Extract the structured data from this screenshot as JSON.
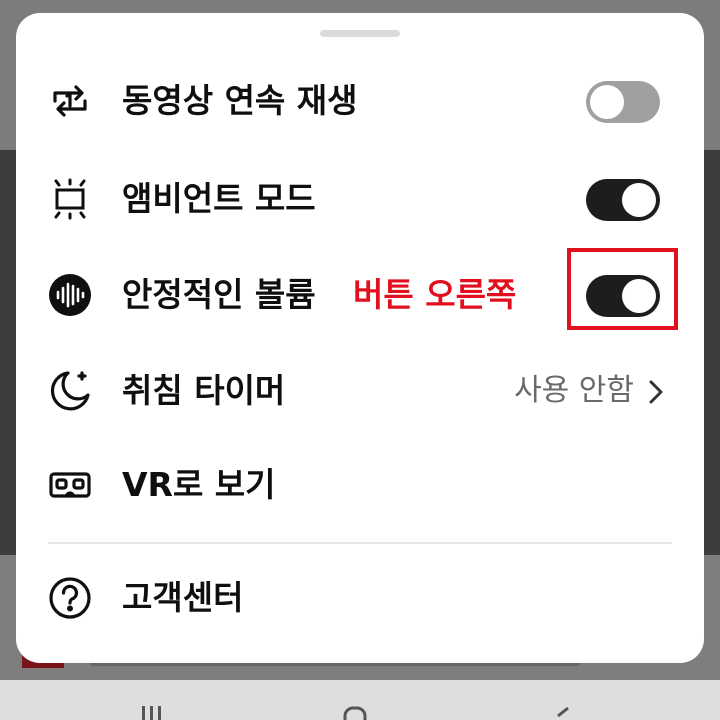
{
  "sheet": {
    "items": [
      {
        "label": "동영상 연속 재생",
        "icon": "repeat-one-icon",
        "toggle": "off"
      },
      {
        "label": "앰비언트 모드",
        "icon": "ambient-mode-icon",
        "toggle": "on"
      },
      {
        "label": "안정적인 볼륨",
        "icon": "stable-volume-icon",
        "toggle": "on",
        "annotation": "버튼 오른쪽"
      },
      {
        "label": "취침 타이머",
        "icon": "moon-timer-icon",
        "value": "사용 안함"
      },
      {
        "label": "VR로 보기",
        "icon": "vr-headset-icon"
      },
      {
        "label": "고객센터",
        "icon": "help-icon"
      }
    ]
  },
  "colors": {
    "annotation": "#e0101e",
    "toggle_on": "#1d1d1d",
    "toggle_off": "#a0a0a0"
  }
}
